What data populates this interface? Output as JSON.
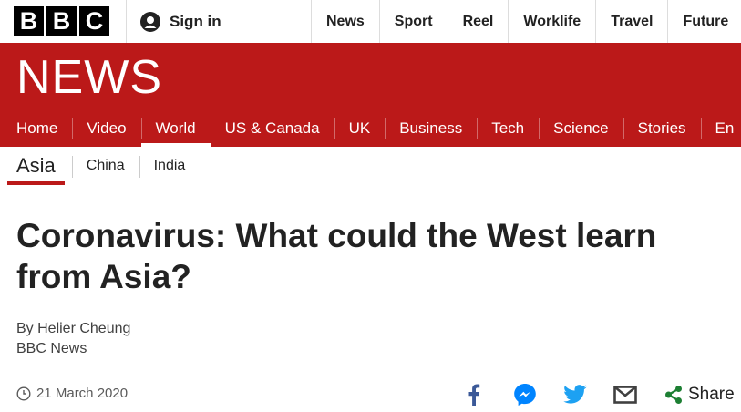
{
  "masthead": {
    "logo_letters": [
      "B",
      "B",
      "C"
    ],
    "sign_in_label": "Sign in",
    "nav": [
      "News",
      "Sport",
      "Reel",
      "Worklife",
      "Travel",
      "Future"
    ]
  },
  "banner": {
    "title": "NEWS"
  },
  "main_nav": {
    "items": [
      "Home",
      "Video",
      "World",
      "US & Canada",
      "UK",
      "Business",
      "Tech",
      "Science",
      "Stories",
      "En"
    ],
    "active": "World"
  },
  "sub_nav": {
    "section": "Asia",
    "items": [
      "China",
      "India"
    ]
  },
  "article": {
    "headline": "Coronavirus: What could the West learn from Asia?",
    "author": "By Helier Cheung",
    "organization": "BBC News",
    "date": "21 March 2020"
  },
  "share": {
    "icons": [
      "facebook-icon",
      "messenger-icon",
      "twitter-icon",
      "email-icon",
      "share-icon"
    ],
    "label": "Share"
  },
  "colors": {
    "brand_red": "#bb1919",
    "share_green": "#1d7f33",
    "facebook": "#3b5998",
    "messenger": "#0084ff",
    "twitter": "#1da1f2"
  }
}
